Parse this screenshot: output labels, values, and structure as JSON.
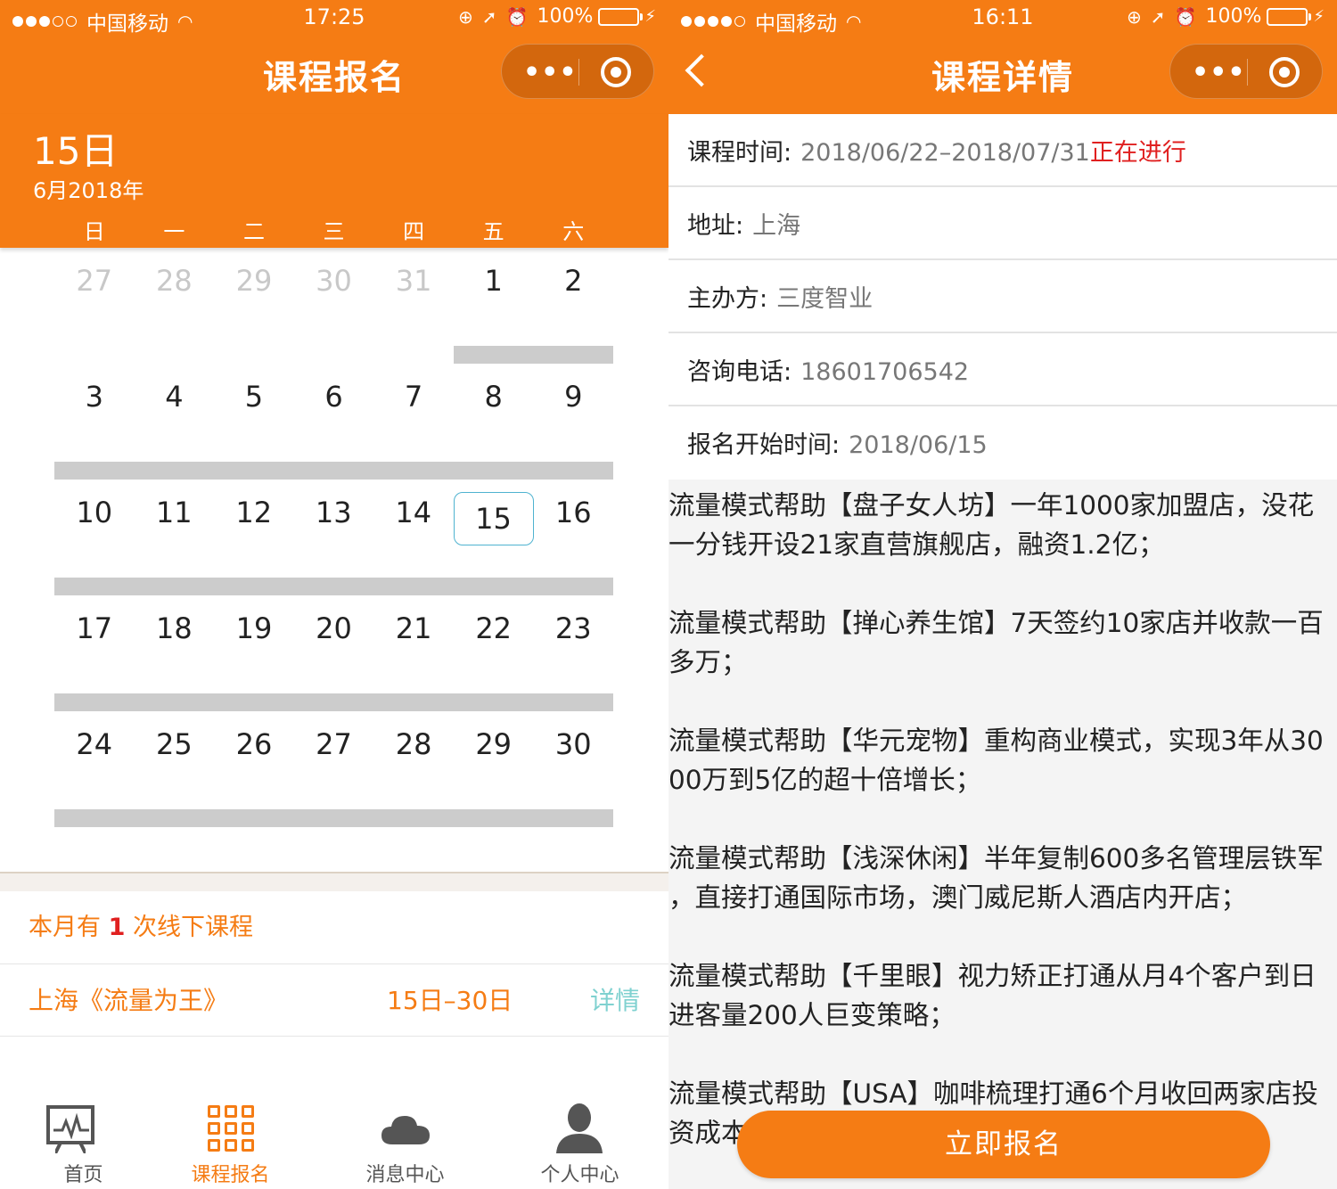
{
  "left": {
    "status": {
      "carrier": "中国移动",
      "time": "17:25",
      "battery": "100%"
    },
    "nav": {
      "title": "课程报名"
    },
    "calendar": {
      "selected_day": "15日",
      "month_year": "6月2018年",
      "weekdays": [
        "日",
        "一",
        "二",
        "三",
        "四",
        "五",
        "六"
      ],
      "weeks": [
        [
          "27",
          "28",
          "29",
          "30",
          "31",
          "1",
          "2"
        ],
        [
          "3",
          "4",
          "5",
          "6",
          "7",
          "8",
          "9"
        ],
        [
          "10",
          "11",
          "12",
          "13",
          "14",
          "15",
          "16"
        ],
        [
          "17",
          "18",
          "19",
          "20",
          "21",
          "22",
          "23"
        ],
        [
          "24",
          "25",
          "26",
          "27",
          "28",
          "29",
          "30"
        ]
      ]
    },
    "summary": {
      "prefix": "本月有 ",
      "count": "1",
      "suffix": " 次线下课程"
    },
    "course": {
      "name": "上海《流量为王》",
      "dates": "15日–30日",
      "detail": "详情"
    },
    "tabs": [
      "首页",
      "课程报名",
      "消息中心",
      "个人中心"
    ]
  },
  "right": {
    "status": {
      "carrier": "中国移动",
      "time": "16:11",
      "battery": "100%"
    },
    "nav": {
      "title": "课程详情"
    },
    "info": {
      "time_label": "课程时间:",
      "time_value": "2018/06/22–2018/07/31",
      "time_status": "正在进行",
      "address_label": "地址:",
      "address_value": "上海",
      "organizer_label": "主办方:",
      "organizer_value": "三度智业",
      "phone_label": "咨询电话:",
      "phone_value": "18601706542",
      "signup_label": "报名开始时间:",
      "signup_value": "2018/06/15"
    },
    "description": [
      "流量模式帮助【盘子女人坊】一年1000家加盟店，没花\n一分钱开设21家直营旗舰店，融资1.2亿；",
      "流量模式帮助【掸心养生馆】7天签约10家店并收款一百\n多万；",
      "流量模式帮助【华元宠物】重构商业模式，实现3年从30\n00万到5亿的超十倍增长；",
      "流量模式帮助【浅深休闲】半年复制600多名管理层铁军\n，直接打通国际市场，澳门威尼斯人酒店内开店；",
      "流量模式帮助【千里眼】视力矫正打通从月4个客户到日\n进客量200人巨变策略；",
      "流量模式帮助【USA】咖啡梳理打通6个月收回两家店投\n资成本"
    ],
    "apply_button": "立即报名"
  }
}
